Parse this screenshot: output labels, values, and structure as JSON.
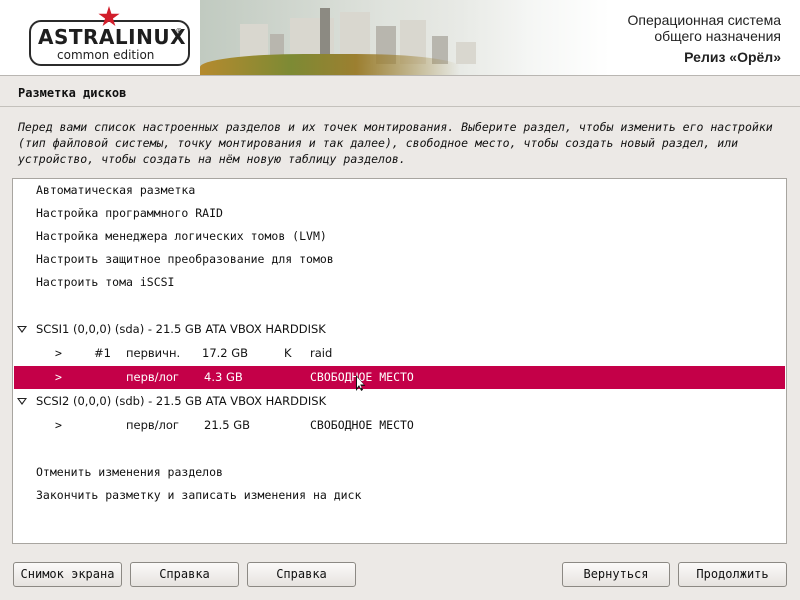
{
  "banner": {
    "logo_text": "ASTRALINUX",
    "logo_sub": "common edition",
    "logo_reg": "®",
    "release_line1": "Операционная система",
    "release_line2": "общего назначения",
    "release_line3": "Релиз «Орёл»"
  },
  "page": {
    "title": "Разметка дисков",
    "description": "Перед вами список настроенных разделов и их точек монтирования. Выберите раздел, чтобы изменить его настройки (тип файловой системы, точку монтирования и так далее), свободное место, чтобы создать новый раздел, или устройство, чтобы создать на нём новую таблицу разделов."
  },
  "menu": {
    "auto": "Автоматическая разметка",
    "raid": "Настройка программного RAID",
    "lvm": "Настройка менеджера логических томов (LVM)",
    "crypto": "Настроить защитное преобразование для томов",
    "iscsi": "Настроить тома iSCSI"
  },
  "disks": {
    "sda": {
      "label": "SCSI1 (0,0,0) (sda) - 21.5 GB ATA VBOX HARDDISK",
      "p1": {
        "arrow": ">",
        "num": "#1",
        "type": "первичн.",
        "size": "17.2 GB",
        "flag": "K",
        "use": "raid"
      },
      "p2": {
        "arrow": ">",
        "num": "",
        "type": "перв/лог",
        "size": "4.3 GB",
        "flag": "",
        "use": "СВОБОДНОЕ МЕСТО"
      }
    },
    "sdb": {
      "label": "SCSI2 (0,0,0) (sdb) - 21.5 GB ATA VBOX HARDDISK",
      "p1": {
        "arrow": ">",
        "num": "",
        "type": "перв/лог",
        "size": "21.5 GB",
        "flag": "",
        "use": "СВОБОДНОЕ МЕСТО"
      }
    }
  },
  "actions": {
    "undo": "Отменить изменения разделов",
    "finish": "Закончить разметку и записать изменения на диск"
  },
  "buttons": {
    "screenshot": "Снимок экрана",
    "help1": "Справка",
    "help2": "Справка",
    "back": "Вернуться",
    "continue": "Продолжить"
  },
  "colors": {
    "selection": "#c40048",
    "logo_star": "#d21e2b"
  }
}
